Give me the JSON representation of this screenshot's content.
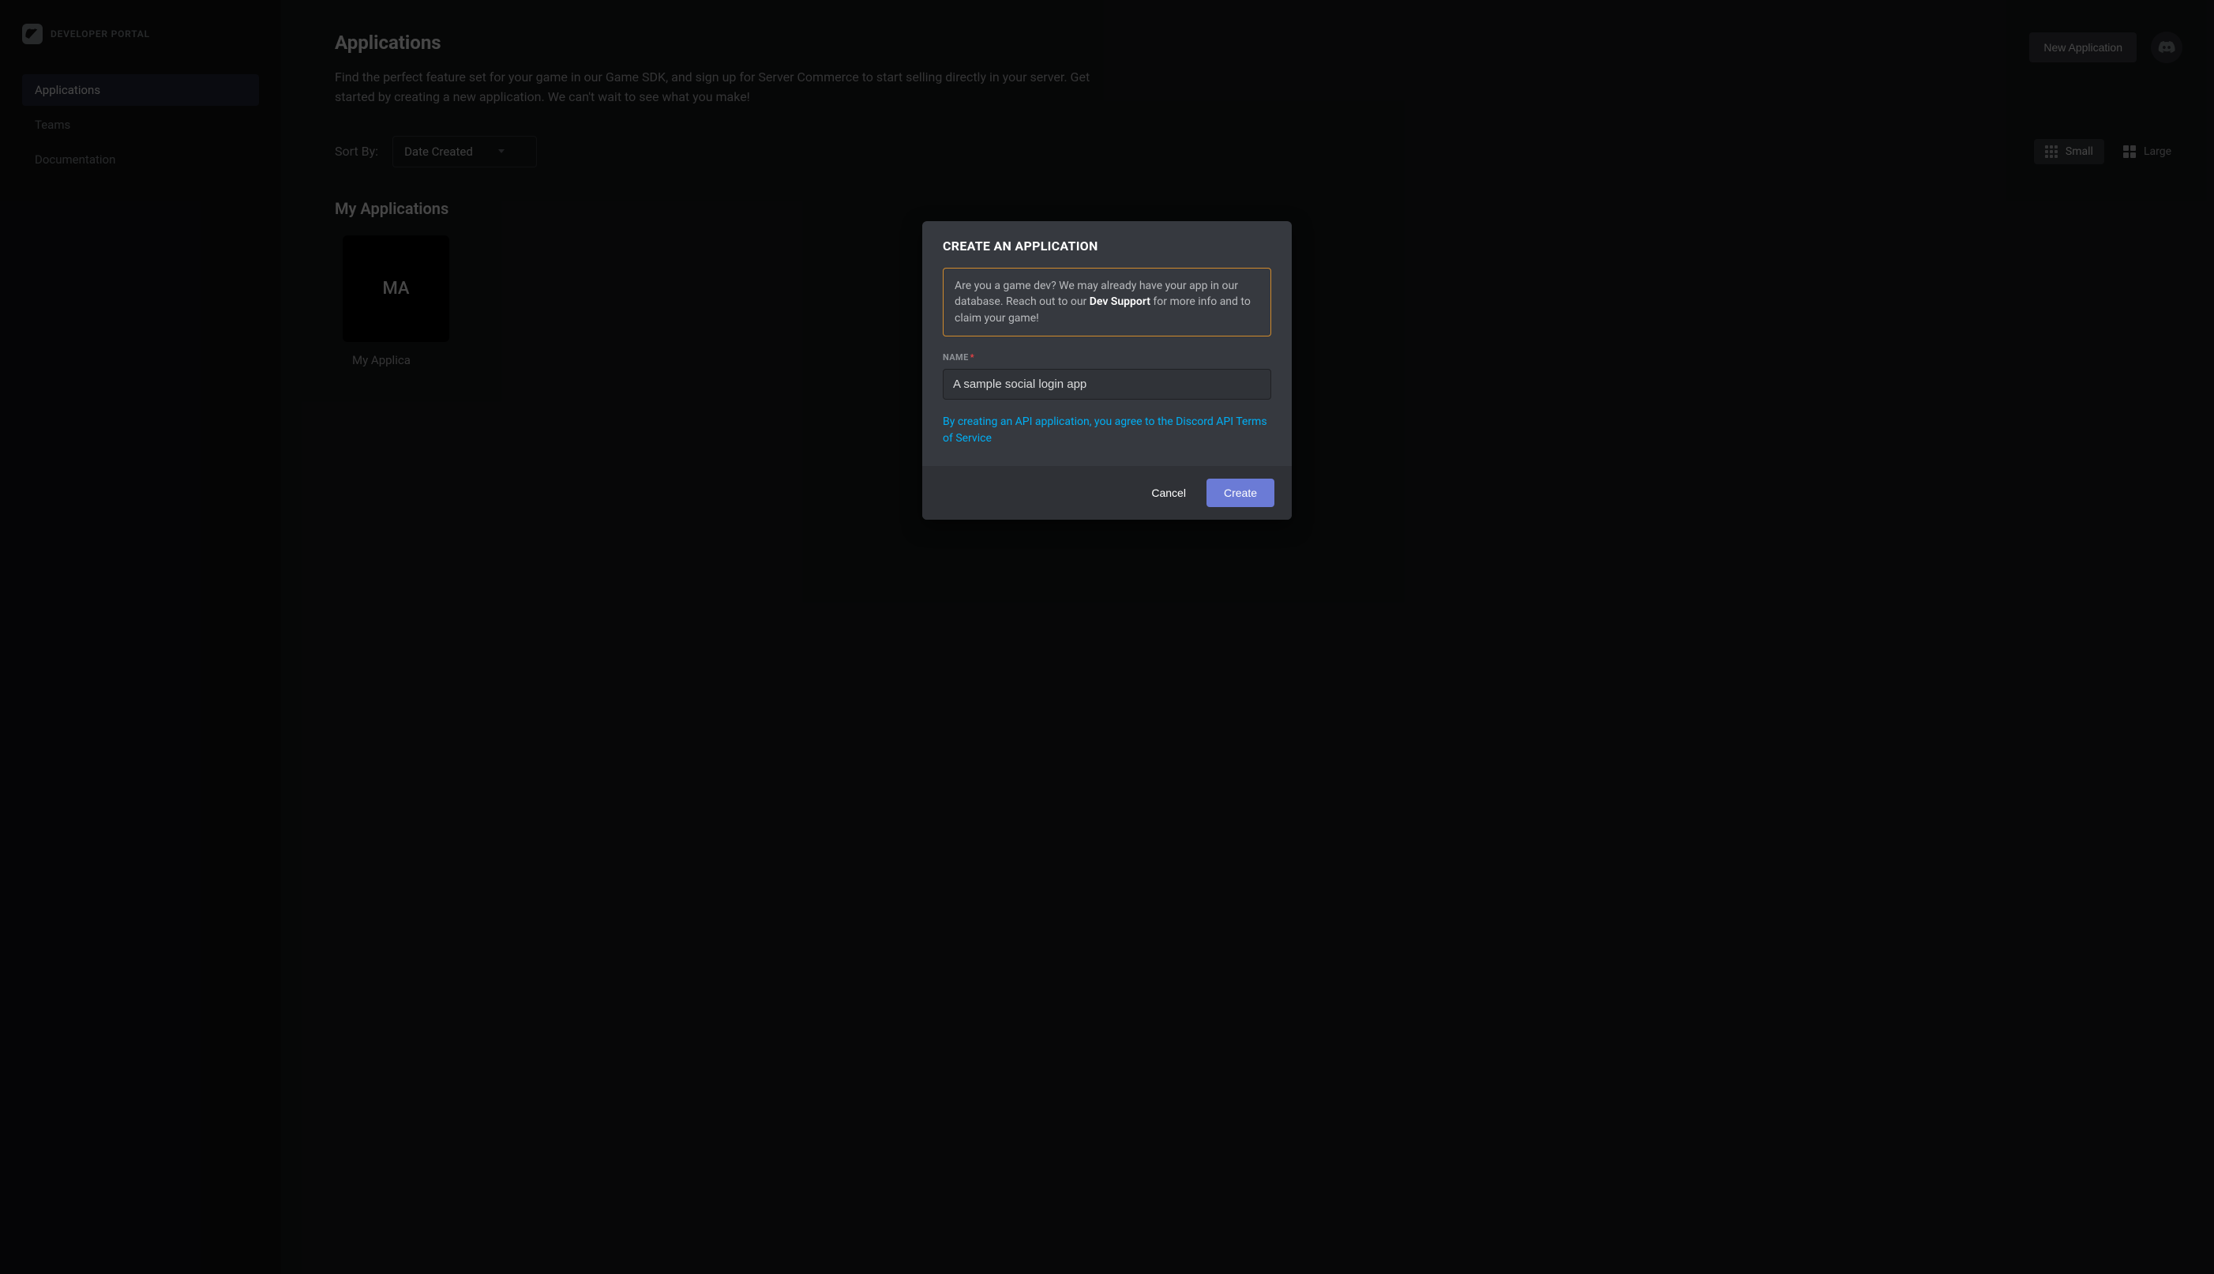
{
  "sidebar": {
    "brand": "DEVELOPER PORTAL",
    "nav": [
      {
        "label": "Applications",
        "active": true
      },
      {
        "label": "Teams",
        "active": false
      },
      {
        "label": "Documentation",
        "active": false
      }
    ]
  },
  "header": {
    "title": "Applications",
    "new_app_label": "New Application"
  },
  "description": "Find the perfect feature set for your game in our Game SDK, and sign up for Server Commerce to start selling directly in your server. Get started by creating a new application. We can't wait to see what you make!",
  "sort": {
    "label": "Sort By:",
    "selected": "Date Created"
  },
  "view": {
    "small_label": "Small",
    "large_label": "Large"
  },
  "section_title": "My Applications",
  "apps": [
    {
      "initials": "MA",
      "name": "My Applica"
    }
  ],
  "modal": {
    "title": "CREATE AN APPLICATION",
    "notice_pre": "Are you a game dev? We may already have your app in our database. Reach out to our ",
    "notice_strong": "Dev Support",
    "notice_post": " for more info and to claim your game!",
    "name_label": "NAME",
    "name_value": "A sample social login app",
    "tos_text": "By creating an API application, you agree to the Discord API Terms of Service",
    "cancel_label": "Cancel",
    "create_label": "Create"
  }
}
